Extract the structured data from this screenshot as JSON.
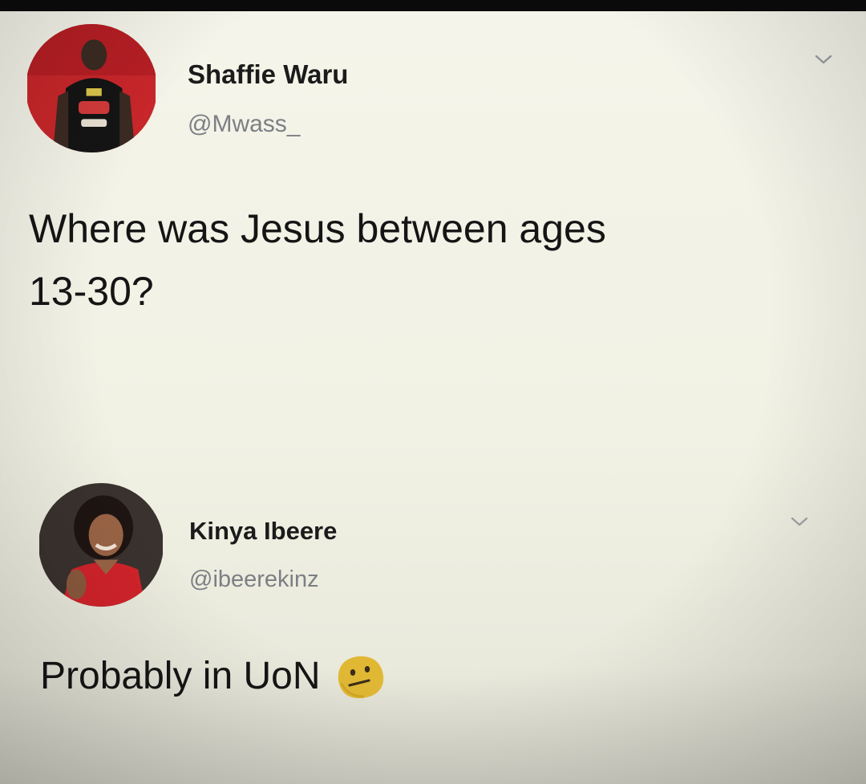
{
  "tweets": [
    {
      "display_name": "Shaffie Waru",
      "handle": "@Mwass_",
      "text": "Where was Jesus between ages 13-30?",
      "avatar_icon": "profile-photo-man-red-background",
      "menu_icon": "chevron-down-icon"
    },
    {
      "display_name": "Kinya Ibeere",
      "handle": "@ibeerekinz",
      "text": "Probably in UoN",
      "emoji_icon": "confused-face-emoji",
      "avatar_icon": "profile-photo-woman-red-top",
      "menu_icon": "chevron-down-icon"
    }
  ],
  "colors": {
    "background": "#f2f2e6",
    "name": "#1b1b1b",
    "handle": "#7c7f84",
    "text": "#151515",
    "emoji": "#e0b834"
  }
}
